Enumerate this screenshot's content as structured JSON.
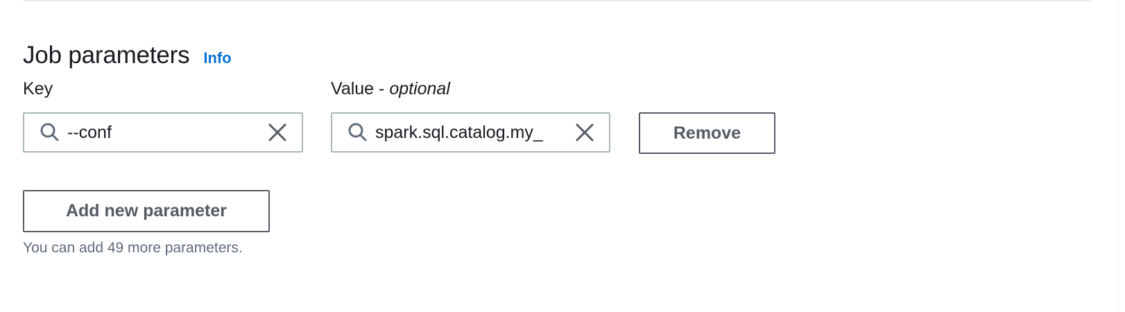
{
  "section": {
    "title": "Job parameters",
    "info_link": "Info"
  },
  "fields": {
    "key_label": "Key",
    "value_label_main": "Value - ",
    "value_label_optional": "optional"
  },
  "parameter_row": {
    "key_value": "--conf",
    "value_value": "spark.sql.catalog.my_",
    "remove_label": "Remove"
  },
  "actions": {
    "add_label": "Add new parameter",
    "hint": "You can add 49 more parameters."
  },
  "icons": {
    "search": "search-icon",
    "clear": "close-icon"
  },
  "colors": {
    "link": "#0972d3",
    "button_border": "#545b64",
    "input_border": "#aab7b8",
    "hint_text": "#5f6b7a"
  }
}
